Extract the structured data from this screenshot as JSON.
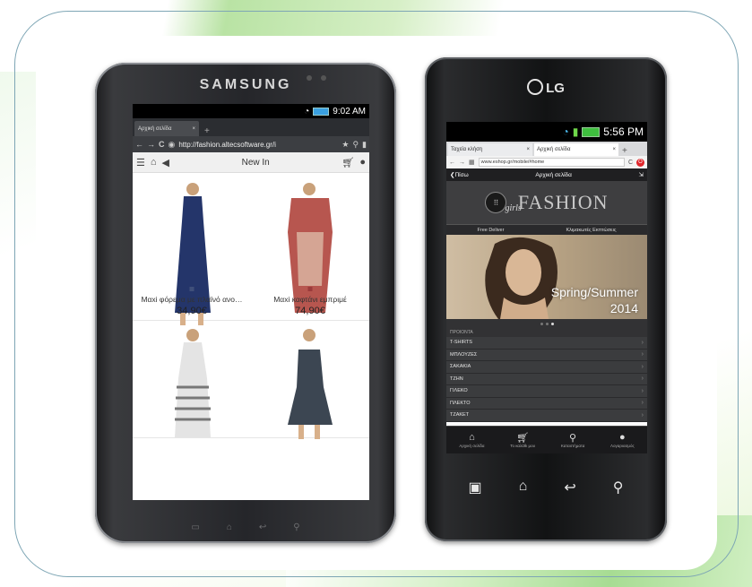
{
  "tablet": {
    "brand": "SAMSUNG",
    "status_time": "9:02 AM",
    "tab_title": "Αρχική σελίδα",
    "url": "http://fashion.altecsoftware.gr/i",
    "nav_title": "New In",
    "products": [
      {
        "name": "Μαxi φόρεμα με πλαϊνό ανο…",
        "price": "34,90€",
        "dress": "#24356a",
        "swatch": true
      },
      {
        "name": "Μαxi καφτάνι εμπριμέ",
        "price": "74,90€",
        "dress": "#b7564f",
        "swatch": true
      },
      {
        "name": "",
        "price": "",
        "dress": "#d9d9d9"
      },
      {
        "name": "",
        "price": "",
        "dress": "#3c4652"
      }
    ]
  },
  "phone": {
    "brand": "LG",
    "status_time": "5:56 PM",
    "tabs": [
      "Ταχεία κλήση",
      "Αρχική σελίδα"
    ],
    "url": "www.eshop.gr/mobile/#home",
    "header_back": "Πίσω",
    "header_title": "Αρχική σελίδα",
    "logo_text": "FASHION",
    "logo_script": "girls",
    "strip": [
      "Free Deliver",
      "Κλιμακωτές Εκπτώσεις"
    ],
    "banner_line1": "Spring/Summer",
    "banner_line2": "2014",
    "section_label": "ΠΡΟΙΟΝΤΑ",
    "categories": [
      "T-SHIRTS",
      "ΜΠΛΟΥΖΕΣ",
      "ΣΑΚΑΚΙΑ",
      "ΤΖΗΝ",
      "ΓΙΛΕΚΟ",
      "ΠΛΕΚΤΟ",
      "ΤΖΑΚΕΤ"
    ],
    "tabbar": [
      "Αρχική σελίδα",
      "Το καλάθι μου",
      "Καταστήματα",
      "Λογαριασμός"
    ]
  }
}
